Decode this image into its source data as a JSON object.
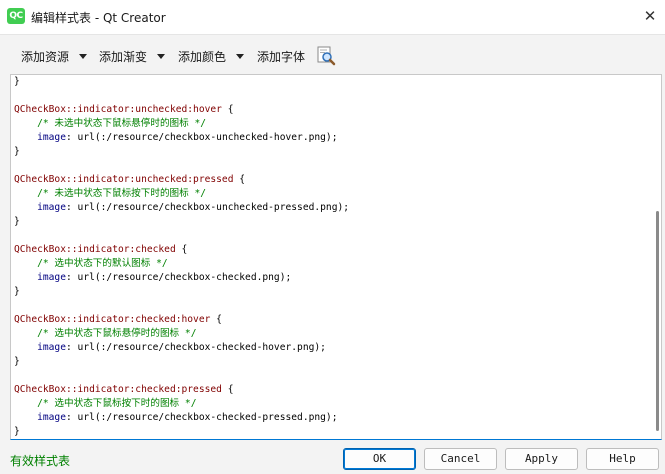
{
  "window": {
    "app_icon": "qt-creator-logo",
    "app_icon_text": "QC",
    "title": "编辑样式表 - Qt Creator",
    "close_symbol": "✕"
  },
  "toolbar": {
    "add_resource": "添加资源",
    "add_gradient": "添加渐变",
    "add_color": "添加颜色",
    "add_font": "添加字体",
    "search_icon": "magnifier-document-icon"
  },
  "code_lines": [
    [
      {
        "t": "}",
        "c": "plain"
      }
    ],
    [
      {
        "t": "",
        "c": "plain"
      }
    ],
    [
      {
        "t": "QCheckBox::indicator:unchecked:hover",
        "c": "sel"
      },
      {
        "t": " {",
        "c": "plain"
      }
    ],
    [
      {
        "t": "    ",
        "c": "plain"
      },
      {
        "t": "/* 未选中状态下鼠标悬停时的图标 */",
        "c": "cmt"
      }
    ],
    [
      {
        "t": "    ",
        "c": "plain"
      },
      {
        "t": "image",
        "c": "prop"
      },
      {
        "t": ": url(:/resource/checkbox-unchecked-hover.png);",
        "c": "plain"
      }
    ],
    [
      {
        "t": "}",
        "c": "plain"
      }
    ],
    [
      {
        "t": "",
        "c": "plain"
      }
    ],
    [
      {
        "t": "QCheckBox::indicator:unchecked:pressed",
        "c": "sel"
      },
      {
        "t": " {",
        "c": "plain"
      }
    ],
    [
      {
        "t": "    ",
        "c": "plain"
      },
      {
        "t": "/* 未选中状态下鼠标按下时的图标 */",
        "c": "cmt"
      }
    ],
    [
      {
        "t": "    ",
        "c": "plain"
      },
      {
        "t": "image",
        "c": "prop"
      },
      {
        "t": ": url(:/resource/checkbox-unchecked-pressed.png);",
        "c": "plain"
      }
    ],
    [
      {
        "t": "}",
        "c": "plain"
      }
    ],
    [
      {
        "t": "",
        "c": "plain"
      }
    ],
    [
      {
        "t": "QCheckBox::indicator:checked",
        "c": "sel"
      },
      {
        "t": " {",
        "c": "plain"
      }
    ],
    [
      {
        "t": "    ",
        "c": "plain"
      },
      {
        "t": "/* 选中状态下的默认图标 */",
        "c": "cmt"
      }
    ],
    [
      {
        "t": "    ",
        "c": "plain"
      },
      {
        "t": "image",
        "c": "prop"
      },
      {
        "t": ": url(:/resource/checkbox-checked.png);",
        "c": "plain"
      }
    ],
    [
      {
        "t": "}",
        "c": "plain"
      }
    ],
    [
      {
        "t": "",
        "c": "plain"
      }
    ],
    [
      {
        "t": "QCheckBox::indicator:checked:hover",
        "c": "sel"
      },
      {
        "t": " {",
        "c": "plain"
      }
    ],
    [
      {
        "t": "    ",
        "c": "plain"
      },
      {
        "t": "/* 选中状态下鼠标悬停时的图标 */",
        "c": "cmt"
      }
    ],
    [
      {
        "t": "    ",
        "c": "plain"
      },
      {
        "t": "image",
        "c": "prop"
      },
      {
        "t": ": url(:/resource/checkbox-checked-hover.png);",
        "c": "plain"
      }
    ],
    [
      {
        "t": "}",
        "c": "plain"
      }
    ],
    [
      {
        "t": "",
        "c": "plain"
      }
    ],
    [
      {
        "t": "QCheckBox::indicator:checked:pressed",
        "c": "sel"
      },
      {
        "t": " {",
        "c": "plain"
      }
    ],
    [
      {
        "t": "    ",
        "c": "plain"
      },
      {
        "t": "/* 选中状态下鼠标按下时的图标 */",
        "c": "cmt"
      }
    ],
    [
      {
        "t": "    ",
        "c": "plain"
      },
      {
        "t": "image",
        "c": "prop"
      },
      {
        "t": ": url(:/resource/checkbox-checked-pressed.png);",
        "c": "plain"
      }
    ],
    [
      {
        "t": "}",
        "c": "plain"
      }
    ]
  ],
  "status": {
    "valid_text": "有效样式表",
    "color": "#008000"
  },
  "buttons": {
    "ok": "OK",
    "cancel": "Cancel",
    "apply": "Apply",
    "help": "Help"
  },
  "colors": {
    "selector": "#800000",
    "comment": "#008000",
    "property": "#000080",
    "accent": "#0078d4"
  }
}
